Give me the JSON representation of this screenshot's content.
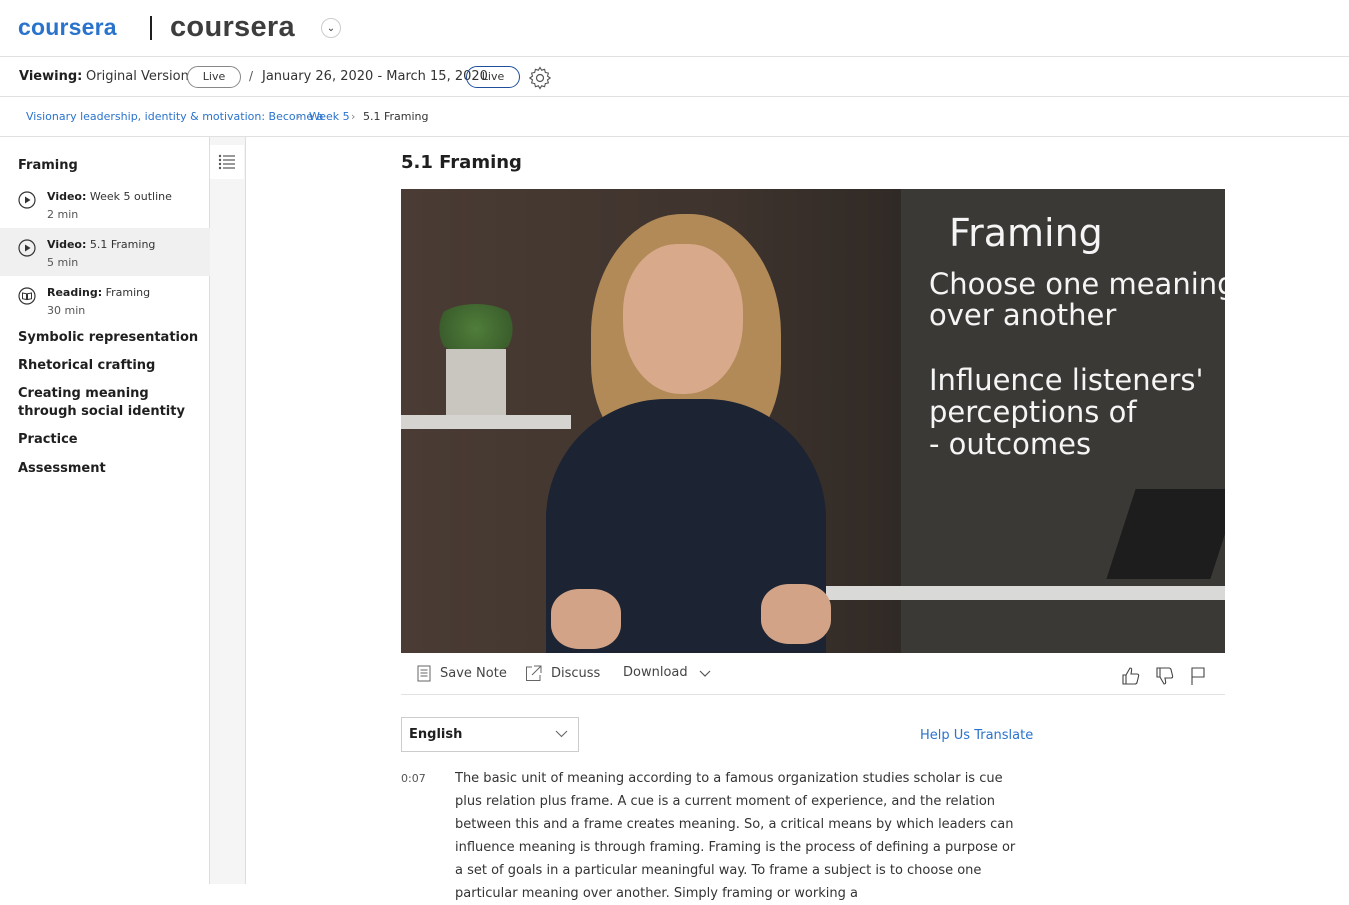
{
  "header": {
    "logo_small": "coursera",
    "logo_big": "coursera",
    "colors": {
      "brand_blue": "#2a73cc",
      "dark_logo": "#3d3d3d"
    }
  },
  "viewing_bar": {
    "label": "Viewing:",
    "version": "Original Version",
    "pill1": "Live",
    "separator": "/",
    "dates": "January 26, 2020 - March 15, 2020",
    "pill2": "Live",
    "settings_icon": "gear-icon"
  },
  "breadcrumb": {
    "course": "Visionary leadership, identity & motivation: Become a",
    "week": "Week 5",
    "current": "5.1 Framing"
  },
  "sidebar": {
    "modules": [
      {
        "label": "Framing"
      },
      {
        "label": "Symbolic representation"
      },
      {
        "label": "Rhetorical crafting"
      },
      {
        "label": "Creating meaning through social identity"
      },
      {
        "label": "Practice"
      },
      {
        "label": "Assessment"
      }
    ],
    "lessons": [
      {
        "kind": "Video:",
        "title": "Week 5 outline",
        "duration": "2 min",
        "icon": "play-circle-icon"
      },
      {
        "kind": "Video:",
        "title": "5.1 Framing",
        "duration": "5 min",
        "icon": "play-circle-icon"
      },
      {
        "kind": "Reading:",
        "title": "Framing",
        "duration": "30 min",
        "icon": "book-circle-icon"
      }
    ]
  },
  "main": {
    "title": "5.1 Framing",
    "video_slide": {
      "heading": "Framing",
      "line1": "Choose one meaning",
      "line2": "over another",
      "line3": "Influence listeners'",
      "line4": "perceptions of",
      "line5": "- outcomes"
    },
    "actions": {
      "save_note": "Save Note",
      "discuss": "Discuss",
      "download": "Download"
    },
    "transcript": {
      "language": "English",
      "help_translate": "Help Us Translate",
      "timestamp": "0:07",
      "text": "The basic unit of meaning according to a famous organization studies scholar is cue plus relation plus frame. A cue is a current moment of experience, and the relation between this and a frame creates meaning. So, a critical means by which leaders can influence meaning is through framing. Framing is the process of defining a purpose or a set of goals in a particular meaningful way. To frame a subject is to choose one particular meaning over another. Simply framing or working a"
    }
  }
}
